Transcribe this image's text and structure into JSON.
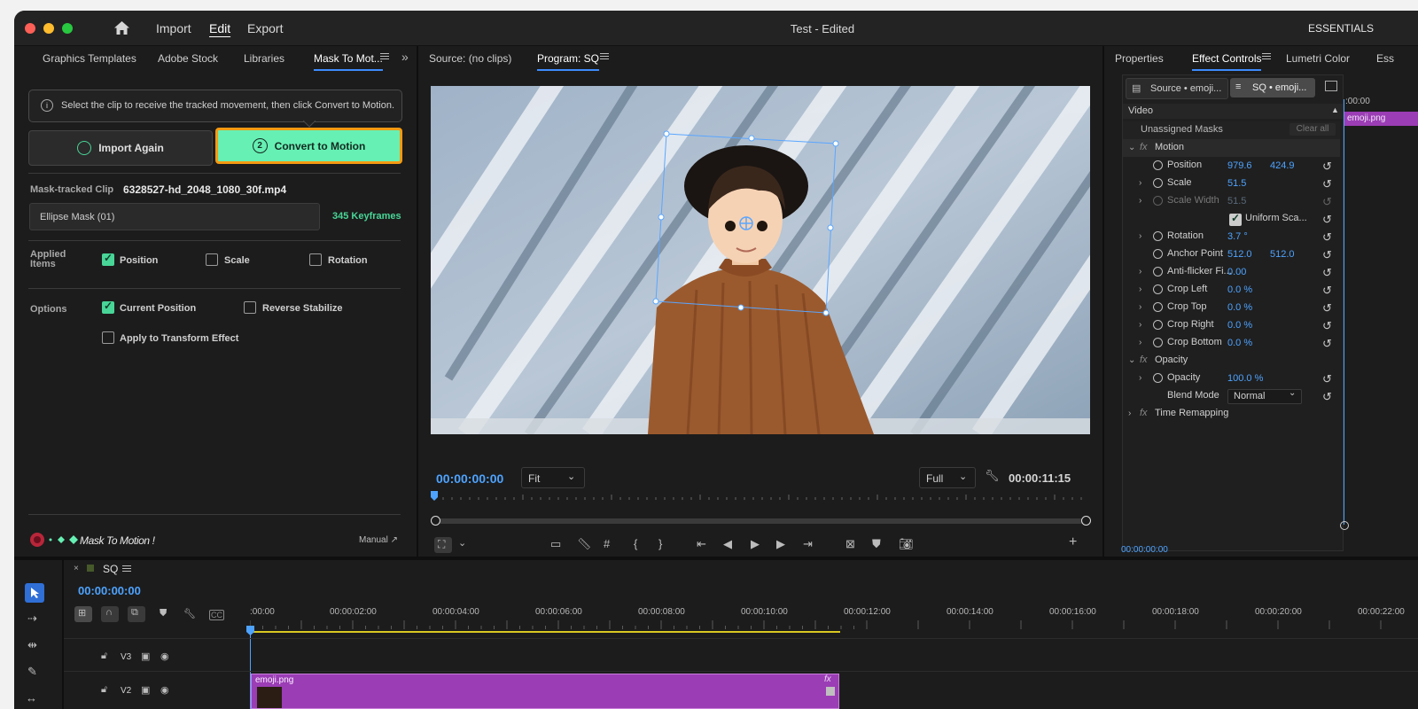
{
  "app": {
    "window_title": "Test - Edited",
    "workspace": "ESSENTIALS",
    "menu": [
      "Import",
      "Edit",
      "Export"
    ],
    "active_menu": "Edit"
  },
  "left_panel": {
    "tabs": [
      "Graphics Templates",
      "Adobe Stock",
      "Libraries",
      "Mask To Mot..."
    ],
    "active_tab": "Mask To Mot...",
    "info_text": "Select the clip to receive the tracked movement, then click Convert to Motion.",
    "import_again": {
      "step": "",
      "label": "Import Again"
    },
    "convert": {
      "step": "2",
      "label": "Convert to Motion"
    },
    "mask_tracked_label": "Mask-tracked Clip",
    "mask_tracked_file": "6328527-hd_2048_1080_30f.mp4",
    "mask_select": "Ellipse Mask (01)",
    "keyframes": "345 Keyframes",
    "applied_items_label": "Applied Items",
    "applied": [
      {
        "label": "Position",
        "checked": true
      },
      {
        "label": "Scale",
        "checked": false
      },
      {
        "label": "Rotation",
        "checked": false
      }
    ],
    "options_label": "Options",
    "options": [
      {
        "label": "Current Position",
        "checked": true
      },
      {
        "label": "Reverse Stabilize",
        "checked": false
      },
      {
        "label": "Apply to Transform Effect",
        "checked": false
      }
    ],
    "brand": "Mask To Motion !",
    "manual": "Manual ↗"
  },
  "monitor": {
    "source_tab": "Source: (no clips)",
    "program_tab": "Program: SQ",
    "timecode_current": "00:00:00:00",
    "fit": "Fit",
    "quality": "Full",
    "timecode_duration": "00:00:11:15"
  },
  "effect_controls": {
    "tabs": [
      "Properties",
      "Effect Controls",
      "Lumetri Color",
      "Ess"
    ],
    "active_tab": "Effect Controls",
    "source_chip": "Source • emoji...",
    "seq_chip": "SQ • emoji...",
    "mini_time": ":00:00",
    "clip_label": "emoji.png",
    "section_video": "Video",
    "unassigned_masks": "Unassigned Masks",
    "clear_all": "Clear all",
    "motion": "Motion",
    "rows": [
      {
        "name": "Position",
        "v1": "979.6",
        "v2": "424.9"
      },
      {
        "name": "Scale",
        "v1": "51.5",
        "v2": ""
      },
      {
        "name": "Scale Width",
        "v1": "51.5",
        "v2": ""
      },
      {
        "name": "Uniform Sca...",
        "v1": "",
        "v2": ""
      },
      {
        "name": "Rotation",
        "v1": "3.7 °",
        "v2": ""
      },
      {
        "name": "Anchor Point",
        "v1": "512.0",
        "v2": "512.0"
      },
      {
        "name": "Anti-flicker Fi...",
        "v1": "0.00",
        "v2": ""
      },
      {
        "name": "Crop Left",
        "v1": "0.0 %",
        "v2": ""
      },
      {
        "name": "Crop Top",
        "v1": "0.0 %",
        "v2": ""
      },
      {
        "name": "Crop Right",
        "v1": "0.0 %",
        "v2": ""
      },
      {
        "name": "Crop Bottom",
        "v1": "0.0 %",
        "v2": ""
      }
    ],
    "opacity_section": "Opacity",
    "opacity_row": {
      "name": "Opacity",
      "v1": "100.0 %"
    },
    "blend_mode_label": "Blend Mode",
    "blend_mode": "Normal",
    "time_remapping": "Time Remapping",
    "footer_time": "00:00:00:00"
  },
  "timeline": {
    "sequence": "SQ",
    "timecode": "00:00:00:00",
    "ruler": [
      ":00:00",
      "00:00:02:00",
      "00:00:04:00",
      "00:00:06:00",
      "00:00:08:00",
      "00:00:10:00",
      "00:00:12:00",
      "00:00:14:00",
      "00:00:16:00",
      "00:00:18:00",
      "00:00:20:00",
      "00:00:22:00"
    ],
    "tracks": [
      "V3",
      "V2"
    ],
    "clip": "emoji.png"
  },
  "colors": {
    "accent_green": "#66f0b4",
    "highlight_orange": "#f59a12",
    "timecode_blue": "#4ea3ff",
    "clip_purple": "#9b3db5"
  }
}
